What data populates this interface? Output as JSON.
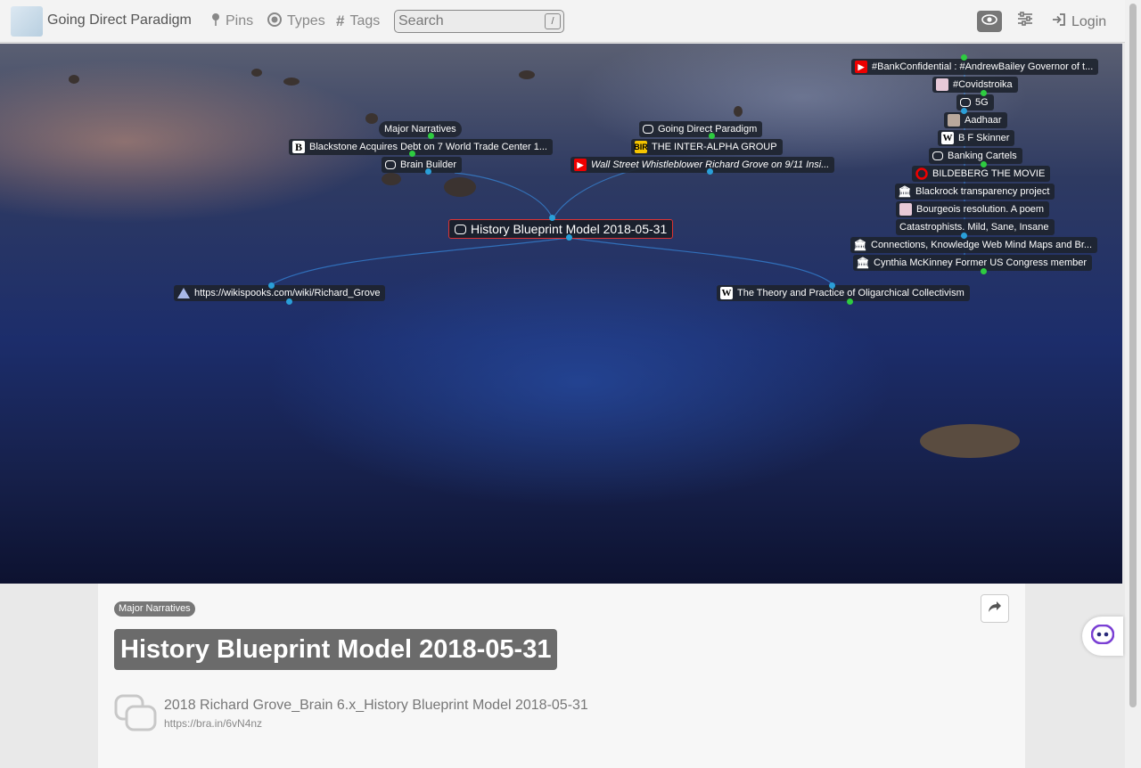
{
  "app": {
    "title": "Going Direct Paradigm"
  },
  "nav": [
    {
      "label": "Pins",
      "icon": "pin-icon"
    },
    {
      "label": "Types",
      "icon": "types-icon"
    },
    {
      "label": "Tags",
      "icon": "hash-icon"
    }
  ],
  "search": {
    "placeholder": "Search",
    "shortcut": "/"
  },
  "toolbar": {
    "login_label": "Login"
  },
  "graph": {
    "active": "History Blueprint Model 2018-05-31",
    "nodes": {
      "major_narratives": "Major Narratives",
      "blackstone": "Blackstone Acquires Debt on 7 World Trade Center 1...",
      "brain_builder": "Brain Builder",
      "going_direct": "Going Direct Paradigm",
      "inter_alpha": "THE INTER-ALPHA GROUP",
      "wall_street": "Wall Street Whistleblower Richard Grove on 9/11 Insi...",
      "wikispooks": "https://wikispooks.com/wiki/Richard_Grove",
      "oligarchical": "The Theory and Practice of Oligarchical Collectivism",
      "bank_confidential": "#BankConfidential : #AndrewBailey Governor of t...",
      "covidstroika": "#Covidstroika",
      "fiveg": "5G",
      "aadhaar": "Aadhaar",
      "bf_skinner": "B F Skinner",
      "banking_cartels": "Banking Cartels",
      "bildeberg": "BILDEBERG THE MOVIE",
      "blackrock": "Blackrock transparency project",
      "bourgeois": "Bourgeois resolution. A poem",
      "catastrophists": "Catastrophists. Mild, Sane, Insane",
      "connections": "Connections, Knowledge Web Mind Maps and Br...",
      "cynthia": "Cynthia McKinney Former US Congress member"
    }
  },
  "thought": {
    "tag": "Major Narratives",
    "title": "History Blueprint Model 2018-05-31",
    "source_name": "2018 Richard Grove_Brain 6.x_History Blueprint Model 2018-05-31",
    "source_url": "https://bra.in/6vN4nz"
  }
}
